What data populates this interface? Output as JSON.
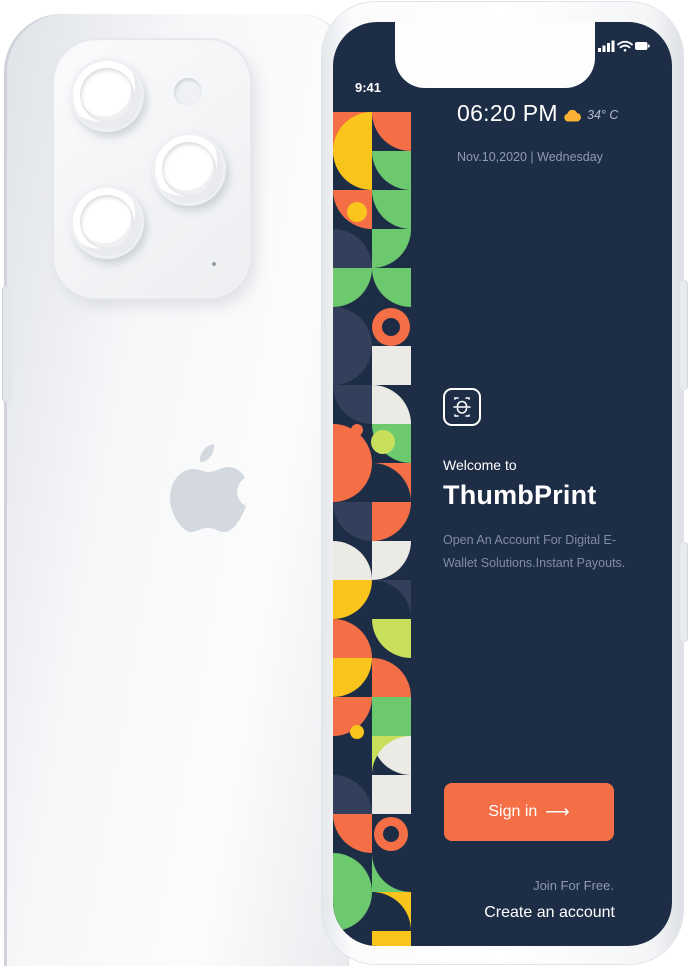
{
  "status_bar": {
    "time": "9:41"
  },
  "header": {
    "clock": "06:20 PM",
    "date": "Nov.10,2020 | Wednesday",
    "weather": {
      "icon": "cloud-icon",
      "temperature": "34° C"
    }
  },
  "welcome": {
    "greeting": "Welcome to",
    "app_name": "ThumbPrint",
    "tagline": "Open An Account For Digital E-Wallet Solutions.Instant Payouts."
  },
  "actions": {
    "sign_in_label": "Sign in",
    "sign_in_icon": "arrow-right-icon",
    "join_text": "Join For Free.",
    "create_account_label": "Create an account"
  },
  "colors": {
    "screen_bg": "#1e2d46",
    "accent": "#f46f45",
    "yellow": "#f9c51c",
    "green": "#6cc96e",
    "lime": "#c8df5c",
    "cream": "#eceae4",
    "slate": "#343f5b"
  }
}
